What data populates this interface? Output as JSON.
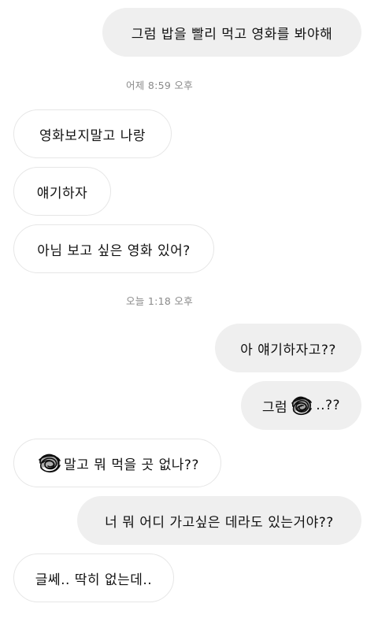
{
  "messages": [
    {
      "side": "out",
      "text": "그럼 밥을 빨리 먹고 영화를 봐야해"
    },
    {
      "side": "in",
      "text": "영화보지말고 나랑"
    },
    {
      "side": "in",
      "text": "얘기하자"
    },
    {
      "side": "in",
      "text": "아님 보고 싶은 영화 있어?"
    },
    {
      "side": "out",
      "text": "아 얘기하자고??"
    },
    {
      "side": "out",
      "text_before": "그럼",
      "text_after": "..??"
    },
    {
      "side": "in",
      "text_after": "말고 뭐 먹을 곳 없나??"
    },
    {
      "side": "out",
      "text": "너 뭐 어디 가고싶은 데라도 있는거야??"
    },
    {
      "side": "in",
      "text": "글쎄.. 딱히 없는데.."
    }
  ],
  "timestamps": [
    "어제 8:59 오후",
    "오늘 1:18 오후"
  ],
  "colors": {
    "outgoing_bubble": "#efefef",
    "incoming_border": "#e6e6e6",
    "timestamp_text": "#8a8a8a"
  }
}
